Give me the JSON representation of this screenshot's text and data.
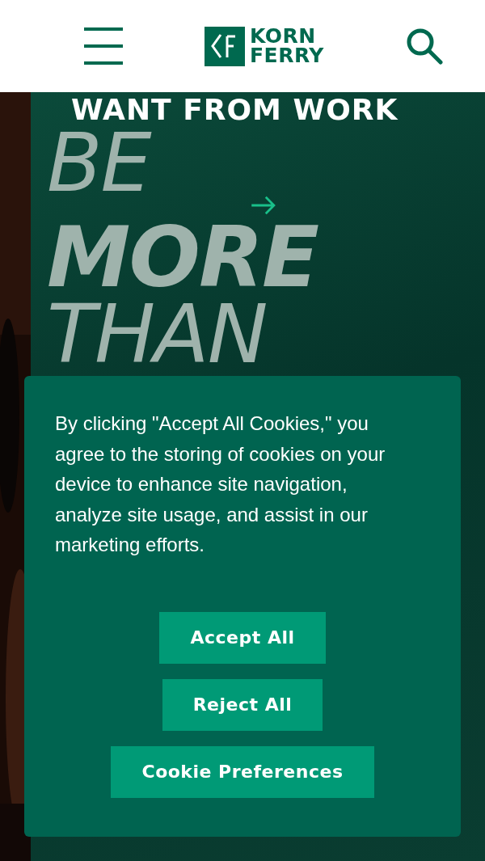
{
  "header": {
    "logo": {
      "line_1": "KORN",
      "line_2": "FERRY"
    }
  },
  "hero": {
    "eyebrow": "WANT FROM WORK",
    "headline": [
      {
        "text": "BE",
        "kind": "light"
      },
      {
        "text": "MORE",
        "kind": "bold"
      },
      {
        "text": "THAN",
        "kind": "light"
      }
    ]
  },
  "cookie_banner": {
    "message": "By clicking \"Accept All Cookies,\" you agree to the storing of cookies on your device to enhance site navigation, analyze site usage, and assist in our marketing efforts.",
    "buttons": [
      {
        "label": "Accept All"
      },
      {
        "label": "Reject All"
      },
      {
        "label": "Cookie Preferences"
      }
    ]
  }
}
